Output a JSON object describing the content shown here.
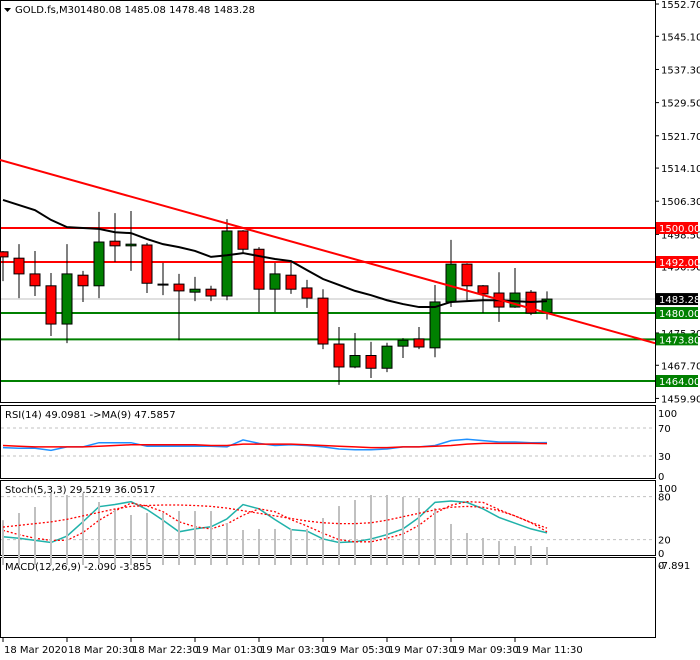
{
  "header": {
    "symbol": "GOLD.fs,M30",
    "ohlc": "1480.08 1485.08 1478.48 1483.28"
  },
  "colors": {
    "bull": "#008000",
    "bear": "#ff0000",
    "ma": "#000000",
    "trendline": "#ff0000",
    "resistance": "#ff0000",
    "support": "#008000",
    "rsi": "#1e90ff",
    "rsi_ma": "#ff0000",
    "stoch_main": "#20b2aa",
    "stoch_signal": "#ff0000",
    "macd_hist": "#c0c0c0",
    "macd_signal": "#ff0000"
  },
  "chart_data": [
    {
      "type": "candlestick",
      "title": "GOLD.fs,M30",
      "ylim": [
        1459.9,
        1552.7
      ],
      "y_ticks": [
        "1552.70",
        "1545.10",
        "1537.30",
        "1529.50",
        "1521.70",
        "1514.10",
        "1506.30",
        "1498.50",
        "1490.90",
        "1475.30",
        "1467.70",
        "1459.90"
      ],
      "x_ticks": [
        "18 Mar 2020",
        "18 Mar 20:30",
        "18 Mar 22:30",
        "19 Mar 01:30",
        "19 Mar 03:30",
        "19 Mar 05:30",
        "19 Mar 07:30",
        "19 Mar 09:30",
        "19 Mar 11:30"
      ],
      "candles": [
        [
          1494.4,
          1494.6,
          1487.5,
          1493.2
        ],
        [
          1492.9,
          1496.2,
          1483.5,
          1489.2
        ],
        [
          1489.2,
          1494.6,
          1484.0,
          1486.4
        ],
        [
          1486.4,
          1489.4,
          1474.6,
          1477.4
        ],
        [
          1477.4,
          1496.2,
          1472.9,
          1489.2
        ],
        [
          1488.9,
          1489.9,
          1482.6,
          1486.4
        ],
        [
          1486.4,
          1503.8,
          1483.5,
          1496.7
        ],
        [
          1496.9,
          1503.5,
          1492.0,
          1495.8
        ],
        [
          1495.8,
          1504.0,
          1489.9,
          1496.2
        ],
        [
          1496.0,
          1496.5,
          1484.7,
          1487.0
        ],
        [
          1486.8,
          1491.8,
          1484.2,
          1486.8
        ],
        [
          1486.8,
          1489.2,
          1473.6,
          1485.2
        ],
        [
          1484.9,
          1488.5,
          1482.8,
          1485.6
        ],
        [
          1485.6,
          1486.4,
          1482.8,
          1484.0
        ],
        [
          1484.0,
          1502.1,
          1483.0,
          1499.3
        ],
        [
          1499.3,
          1499.5,
          1494.1,
          1495.0
        ],
        [
          1495.0,
          1495.5,
          1480.2,
          1485.6
        ],
        [
          1485.6,
          1491.8,
          1480.2,
          1489.2
        ],
        [
          1488.9,
          1491.8,
          1484.5,
          1485.6
        ],
        [
          1485.9,
          1487.8,
          1481.2,
          1483.5
        ],
        [
          1483.5,
          1485.6,
          1471.5,
          1472.7
        ],
        [
          1472.7,
          1476.7,
          1463.1,
          1467.3
        ],
        [
          1467.3,
          1475.3,
          1467.0,
          1470.0
        ],
        [
          1470.0,
          1473.2,
          1464.7,
          1467.0
        ],
        [
          1467.0,
          1473.0,
          1466.1,
          1472.2
        ],
        [
          1472.2,
          1474.1,
          1469.4,
          1473.6
        ],
        [
          1473.9,
          1476.7,
          1471.5,
          1472.0
        ],
        [
          1471.8,
          1486.6,
          1469.6,
          1482.6
        ],
        [
          1482.6,
          1497.2,
          1481.4,
          1491.5
        ],
        [
          1491.5,
          1491.7,
          1483.0,
          1486.4
        ],
        [
          1486.4,
          1486.6,
          1480.0,
          1484.5
        ],
        [
          1484.7,
          1489.6,
          1477.9,
          1481.4
        ],
        [
          1481.4,
          1490.6,
          1481.2,
          1484.7
        ],
        [
          1484.9,
          1485.4,
          1479.5,
          1480.0
        ],
        [
          1480.08,
          1485.08,
          1478.48,
          1483.28
        ]
      ],
      "ma": [
        1506.6,
        1505.4,
        1504.2,
        1501.9,
        1500.2,
        1500.0,
        1499.8,
        1499.0,
        1498.8,
        1497.4,
        1496.2,
        1495.5,
        1494.6,
        1493.2,
        1493.6,
        1494.1,
        1493.4,
        1492.7,
        1492.2,
        1490.1,
        1488.0,
        1486.6,
        1485.2,
        1484.2,
        1483.0,
        1482.1,
        1481.4,
        1481.4,
        1482.6,
        1482.8,
        1483.0,
        1483.0,
        1482.8,
        1482.6,
        1482.8
      ],
      "trendline": {
        "from_price": 1516.0,
        "to_price": 1472.9
      },
      "levels": [
        {
          "price": 1500.0,
          "label": "1500.00",
          "kind": "resistance"
        },
        {
          "price": 1492.0,
          "label": "1492.00",
          "kind": "resistance"
        },
        {
          "price": 1480.0,
          "label": "1480.00",
          "kind": "support"
        },
        {
          "price": 1473.8,
          "label": "1473.80",
          "kind": "support"
        },
        {
          "price": 1464.0,
          "label": "1464.00",
          "kind": "support"
        }
      ],
      "current_price": {
        "price": 1483.28,
        "label": "1483.28"
      }
    },
    {
      "type": "line",
      "title": "RSI(14) 49.0981  ->MA(9) 47.5857",
      "ylim": [
        0,
        100
      ],
      "y_ticks": [
        "100",
        "70",
        "30",
        "0"
      ],
      "levels": [
        70,
        30
      ],
      "series": [
        {
          "name": "RSI(14)",
          "values": [
            42,
            41,
            41,
            38,
            43,
            43,
            49,
            49,
            49,
            44,
            44,
            44,
            44,
            44,
            43,
            53,
            48,
            45,
            46,
            45,
            43,
            40,
            39,
            39,
            40,
            43,
            43,
            45,
            52,
            54,
            52,
            50,
            50,
            49,
            49.1
          ]
        },
        {
          "name": "MA(9)",
          "values": [
            45,
            44,
            43,
            43,
            43,
            43,
            44,
            45,
            46,
            46,
            46,
            46,
            46,
            45,
            45,
            47,
            47,
            47,
            47,
            46,
            45,
            44,
            43,
            42,
            42,
            43,
            43,
            44,
            45,
            47,
            48,
            48,
            48,
            48,
            47.6
          ]
        }
      ]
    },
    {
      "type": "line",
      "title": "Stoch(5,3,3) 29.5219 36.0517",
      "ylim": [
        0,
        100
      ],
      "y_ticks": [
        "100",
        "80",
        "20",
        "0"
      ],
      "levels": [
        80,
        20
      ],
      "series": [
        {
          "name": "main",
          "values": [
            24,
            22,
            19,
            16,
            25,
            45,
            66,
            69,
            73,
            62,
            47,
            31,
            35,
            38,
            49,
            69,
            63,
            48,
            34,
            32,
            21,
            16,
            17,
            21,
            27,
            35,
            51,
            72,
            74,
            72,
            63,
            51,
            43,
            35,
            29.5
          ]
        },
        {
          "name": "signal",
          "values": [
            33,
            27,
            22,
            19,
            19,
            30,
            47,
            60,
            71,
            67,
            59,
            45,
            38,
            35,
            42,
            54,
            63,
            59,
            48,
            39,
            29,
            20,
            17,
            17,
            22,
            28,
            40,
            57,
            68,
            73,
            72,
            62,
            53,
            44,
            36.1
          ]
        }
      ]
    },
    {
      "type": "bar",
      "title": "MACD(12,26,9) -2.090 -3.855",
      "ylim": [
        -7.891,
        0
      ],
      "y_ticks": [
        "0",
        "-7.891"
      ],
      "series": [
        {
          "name": "macd",
          "values": [
            -5.2,
            -6.03,
            -6.73,
            -8.35,
            -8.12,
            -8.35,
            -7.31,
            -6.5,
            -5.8,
            -6.03,
            -6.03,
            -6.26,
            -6.26,
            -6.26,
            -4.87,
            -4.06,
            -4.18,
            -4.18,
            -4.18,
            -4.18,
            -5.45,
            -6.84,
            -7.54,
            -8.12,
            -8.12,
            -7.89,
            -7.77,
            -6.61,
            -4.76,
            -3.71,
            -3.13,
            -2.78,
            -2.2,
            -2.2,
            -2.09
          ]
        },
        {
          "name": "signal",
          "values": [
            -4.4,
            -4.6,
            -4.8,
            -5.0,
            -5.3,
            -5.7,
            -6.1,
            -6.5,
            -6.8,
            -6.9,
            -6.96,
            -6.96,
            -6.9,
            -6.8,
            -6.6,
            -6.3,
            -6.0,
            -5.7,
            -5.4,
            -5.1,
            -4.9,
            -4.8,
            -4.8,
            -4.9,
            -5.2,
            -5.6,
            -6.0,
            -6.4,
            -6.7,
            -6.8,
            -6.7,
            -6.3,
            -5.7,
            -4.9,
            -3.855
          ]
        }
      ]
    }
  ]
}
